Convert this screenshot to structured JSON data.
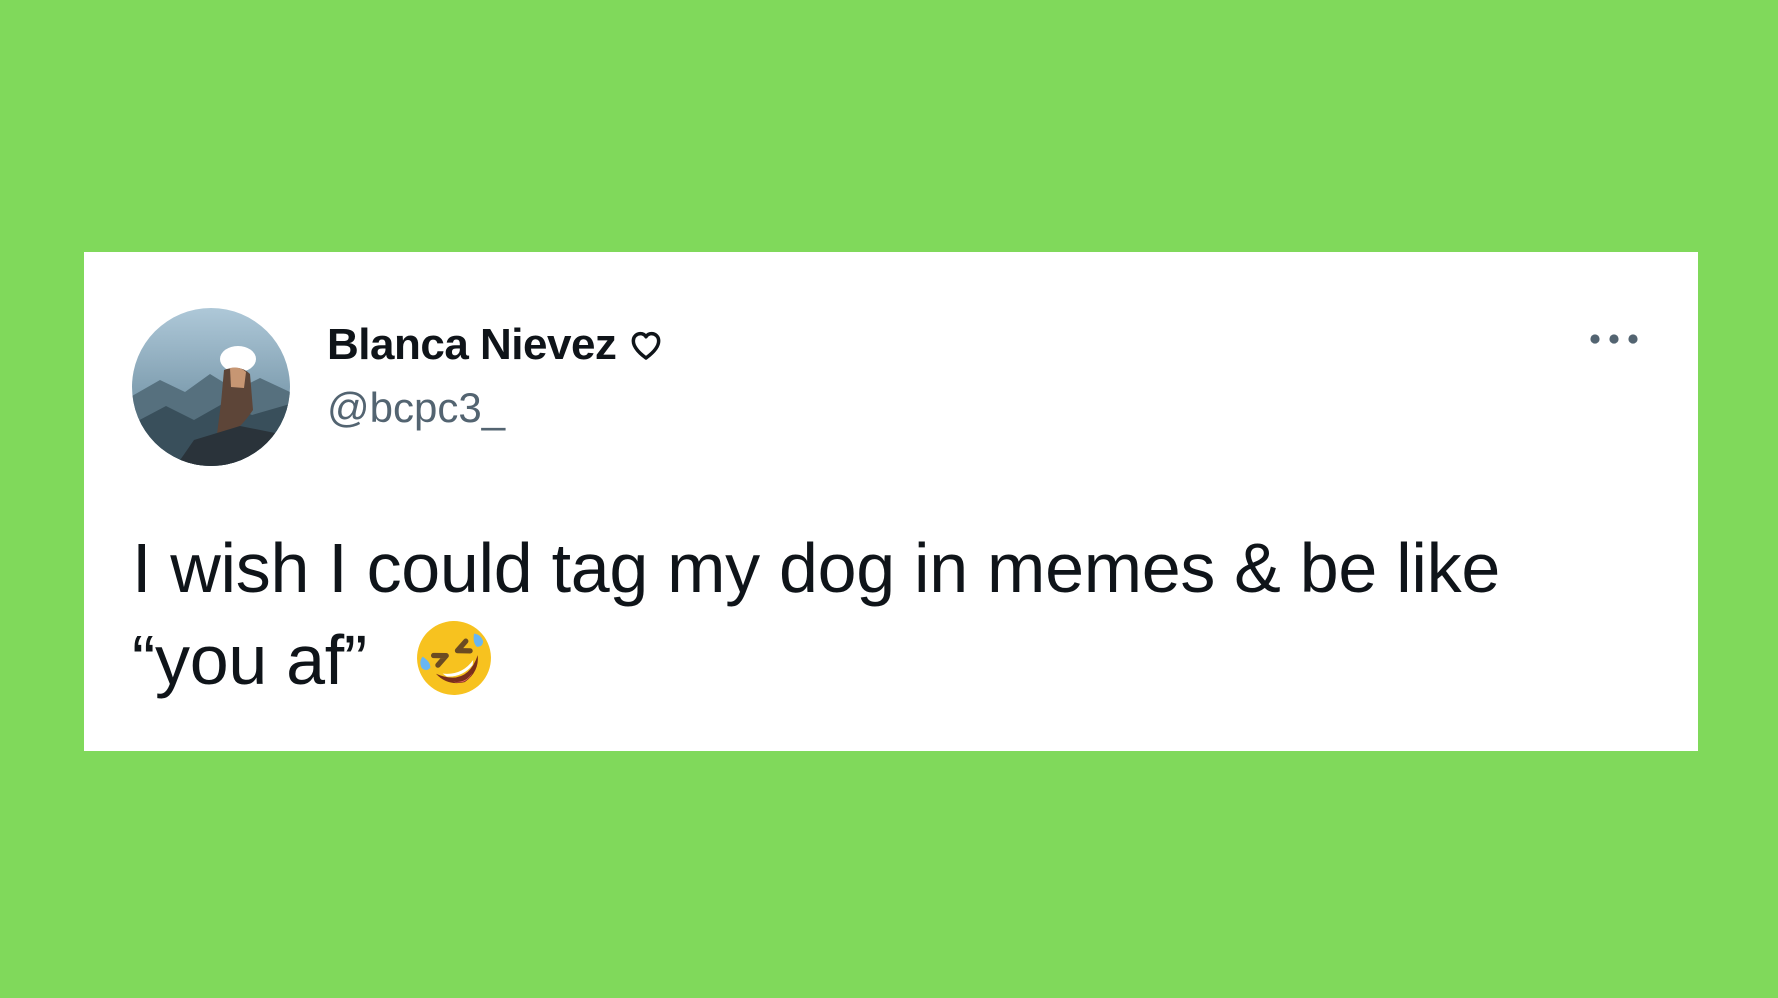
{
  "background_color": "#80d95b",
  "tweet": {
    "display_name": "Blanca Nievez",
    "name_badge_icon": "heart-outline-icon",
    "handle": "@bcpc3_",
    "more_icon": "more-horizontal-icon",
    "text_line_1": "I wish I could tag my dog in memes & be like",
    "text_line_2": "“you af”",
    "emoji": "rolling-on-floor-laughing-emoji"
  }
}
